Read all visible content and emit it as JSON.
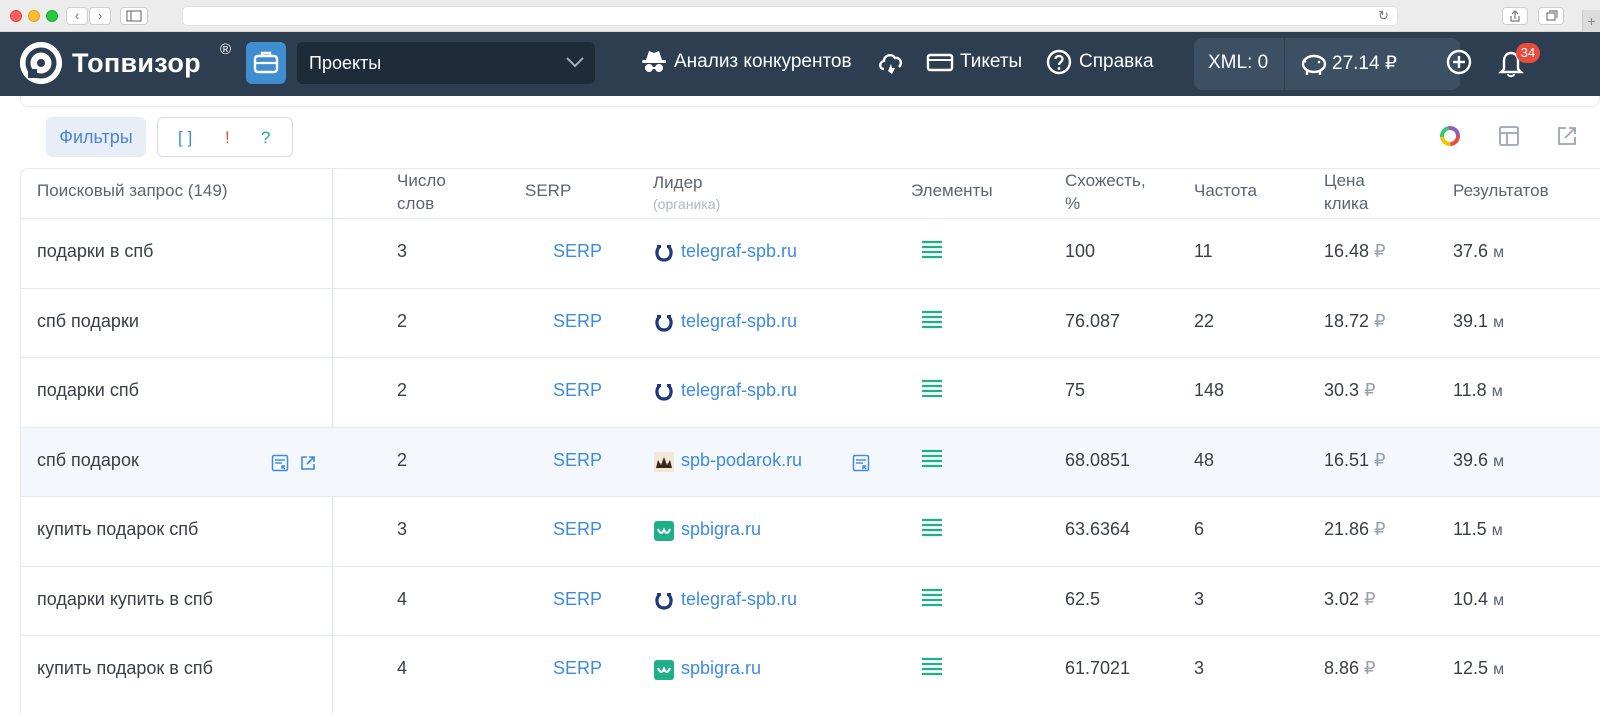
{
  "browser": {
    "add_tab_label": "+"
  },
  "header": {
    "logo_text": "Топвизор",
    "logo_reg": "®",
    "projects_label": "Проекты",
    "nav": {
      "competitors": "Анализ конкурентов",
      "tickets": "Тикеты",
      "help": "Справка"
    },
    "xml": "XML: 0",
    "balance": "27.14 ₽",
    "notifications_count": "34"
  },
  "toolbar": {
    "filters_label": "Фильтры",
    "flag_brackets": "[ ]",
    "flag_exclaim": "!",
    "flag_question": "?"
  },
  "table": {
    "headers": {
      "query": "Поисковый запрос  (149)",
      "words": "Число слов",
      "serp": "SERP",
      "leader": "Лидер",
      "leader_sub": "(органика)",
      "elements": "Элементы",
      "similarity": "Схожесть, %",
      "frequency": "Частота",
      "price": "Цена клика",
      "results": "Результатов"
    },
    "rows": [
      {
        "query": "подарки в спб",
        "words": "3",
        "serp": "SERP",
        "leader": "telegraf-spb.ru",
        "leader_icon": "horseshoe-icon",
        "similarity": "100",
        "frequency": "11",
        "price": "16.48",
        "currency": "₽",
        "results": "37.6",
        "results_unit": "м"
      },
      {
        "query": "спб подарки",
        "words": "2",
        "serp": "SERP",
        "leader": "telegraf-spb.ru",
        "leader_icon": "horseshoe-icon",
        "similarity": "76.087",
        "frequency": "22",
        "price": "18.72",
        "currency": "₽",
        "results": "39.1",
        "results_unit": "м"
      },
      {
        "query": "подарки спб",
        "words": "2",
        "serp": "SERP",
        "leader": "telegraf-spb.ru",
        "leader_icon": "horseshoe-icon",
        "similarity": "75",
        "frequency": "148",
        "price": "30.3",
        "currency": "₽",
        "results": "11.8",
        "results_unit": "м"
      },
      {
        "query": "спб подарок",
        "words": "2",
        "serp": "SERP",
        "leader": "spb-podarok.ru",
        "leader_icon": "crown-icon",
        "similarity": "68.0851",
        "frequency": "48",
        "price": "16.51",
        "currency": "₽",
        "results": "39.6",
        "results_unit": "м"
      },
      {
        "query": "купить подарок спб",
        "words": "3",
        "serp": "SERP",
        "leader": "spbigra.ru",
        "leader_icon": "game-icon",
        "similarity": "63.6364",
        "frequency": "6",
        "price": "21.86",
        "currency": "₽",
        "results": "11.5",
        "results_unit": "м"
      },
      {
        "query": "подарки купить в спб",
        "words": "4",
        "serp": "SERP",
        "leader": "telegraf-spb.ru",
        "leader_icon": "horseshoe-icon",
        "similarity": "62.5",
        "frequency": "3",
        "price": "3.02",
        "currency": "₽",
        "results": "10.4",
        "results_unit": "м"
      },
      {
        "query": "купить подарок в спб",
        "words": "4",
        "serp": "SERP",
        "leader": "spbigra.ru",
        "leader_icon": "game-icon",
        "similarity": "61.7021",
        "frequency": "3",
        "price": "8.86",
        "currency": "₽",
        "results": "12.5",
        "results_unit": "м"
      }
    ]
  },
  "colors": {
    "header_bg": "#2d3e50",
    "accent_blue": "#3c8be0",
    "elements_green": "#1fb08a",
    "badge_red": "#e74c3c"
  }
}
